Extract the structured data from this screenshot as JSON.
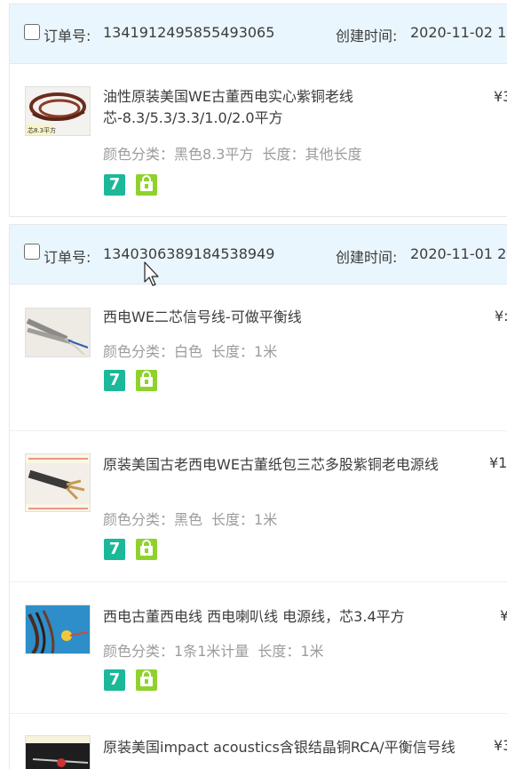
{
  "orders": [
    {
      "checkbox_checked": false,
      "order_no_label": "订单号:",
      "order_no": "1341912495855493065",
      "time_label": "创建时间:",
      "created_time": "2020-11-02 1",
      "items": [
        {
          "title": "油性原装美国WE古董西电实心紫铜老线芯-8.3/5.3/3.3/1.0/2.0平方",
          "sku_color_label": "颜色分类：",
          "sku_color": "黑色8.3平方",
          "sku_length_label": "长度：",
          "sku_length": "其他长度",
          "price": "¥3",
          "thumb_caption": "芯8.3平方"
        }
      ]
    },
    {
      "checkbox_checked": false,
      "order_no_label": "订单号:",
      "order_no": "1340306389184538949",
      "time_label": "创建时间:",
      "created_time": "2020-11-01 2",
      "items": [
        {
          "title": "西电WE二芯信号线-可做平衡线",
          "sku_color_label": "颜色分类：",
          "sku_color": "白色",
          "sku_length_label": "长度：",
          "sku_length": "1米",
          "price": "¥:"
        },
        {
          "title": "原装美国古老西电WE古董纸包三芯多股紫铜老电源线",
          "sku_color_label": "颜色分类：",
          "sku_color": "黑色",
          "sku_length_label": "长度：",
          "sku_length": "1米",
          "price": "¥1"
        },
        {
          "title": "西电古董西电线 西电喇叭线 电源线，芯3.4平方",
          "sku_color_label": "颜色分类：",
          "sku_color": "1条1米计量",
          "sku_length_label": "长度：",
          "sku_length": "1米",
          "price": "¥"
        },
        {
          "title": "原装美国impact acoustics含银结晶铜RCA/平衡信号线",
          "price": "¥3"
        }
      ]
    }
  ],
  "badges": {
    "seven_day": "7",
    "seven_day_icon": "seven-day-return-icon",
    "gift_icon": "shopping-bag-icon"
  },
  "colors": {
    "header_bg": "#eaf6fd",
    "badge_green": "#1bb89a",
    "badge_lime": "#8fd22c",
    "muted_text": "#9c9c9c"
  }
}
